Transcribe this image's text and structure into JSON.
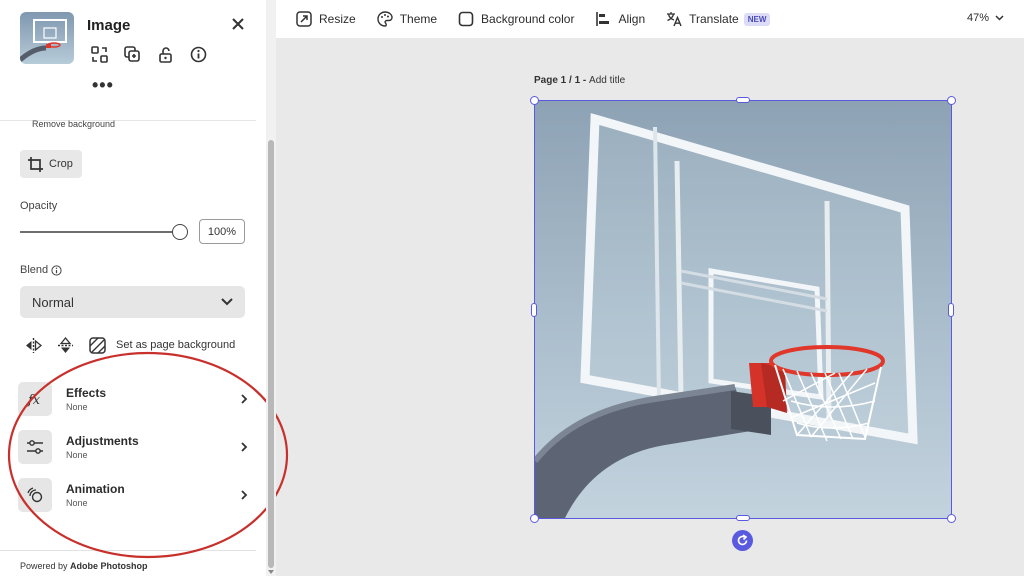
{
  "panel": {
    "title": "Image",
    "more": "•••",
    "remove_background": "Remove background",
    "crop_label": "Crop",
    "opacity_label": "Opacity",
    "opacity_value": "100%",
    "opacity_level": 1.0,
    "blend_label": "Blend",
    "blend_value": "Normal",
    "set_page_bg": "Set as page background",
    "sections": [
      {
        "title": "Effects",
        "subtitle": "None",
        "icon": "fx-icon"
      },
      {
        "title": "Adjustments",
        "subtitle": "None",
        "icon": "sliders-icon"
      },
      {
        "title": "Animation",
        "subtitle": "None",
        "icon": "animation-icon"
      }
    ],
    "powered_prefix": "Powered by ",
    "powered_brand": "Adobe Photoshop"
  },
  "toolbar": {
    "resize": "Resize",
    "theme": "Theme",
    "background_color": "Background color",
    "align": "Align",
    "translate": "Translate",
    "new_badge": "NEW",
    "zoom": "47%"
  },
  "canvas": {
    "page_label_prefix": "Page 1 / 1 - ",
    "page_label_action": "Add title"
  },
  "colors": {
    "accent": "#5a5ae0",
    "annotation": "#c8302c",
    "backboard_rim": "#e0372a"
  }
}
